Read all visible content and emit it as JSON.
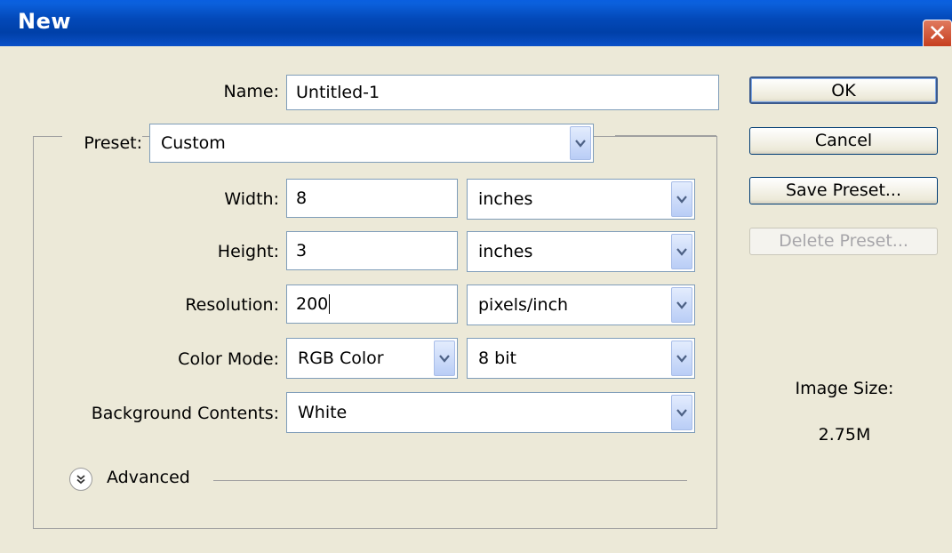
{
  "window": {
    "title": "New",
    "close_glyph": "✕"
  },
  "name": {
    "label": "Name:",
    "value": "Untitled-1"
  },
  "preset": {
    "label": "Preset:",
    "value": "Custom"
  },
  "width": {
    "label": "Width:",
    "value": "8",
    "unit": "inches"
  },
  "height": {
    "label": "Height:",
    "value": "3",
    "unit": "inches"
  },
  "resolution": {
    "label": "Resolution:",
    "value": "200",
    "unit": "pixels/inch"
  },
  "color_mode": {
    "label": "Color Mode:",
    "value": "RGB Color",
    "depth": "8 bit"
  },
  "background": {
    "label": "Background Contents:",
    "value": "White"
  },
  "advanced": {
    "label": "Advanced"
  },
  "buttons": {
    "ok": "OK",
    "cancel": "Cancel",
    "save_preset": "Save Preset...",
    "delete_preset": "Delete Preset..."
  },
  "image_size": {
    "label": "Image Size:",
    "value": "2.75M"
  },
  "colors": {
    "titlebar": "#0349b9",
    "dialog_bg": "#ece9d8",
    "close": "#c43a1a"
  },
  "icons": {
    "dropdown": "chevron-down-icon",
    "advanced": "double-chevron-down-icon",
    "close": "close-icon"
  }
}
